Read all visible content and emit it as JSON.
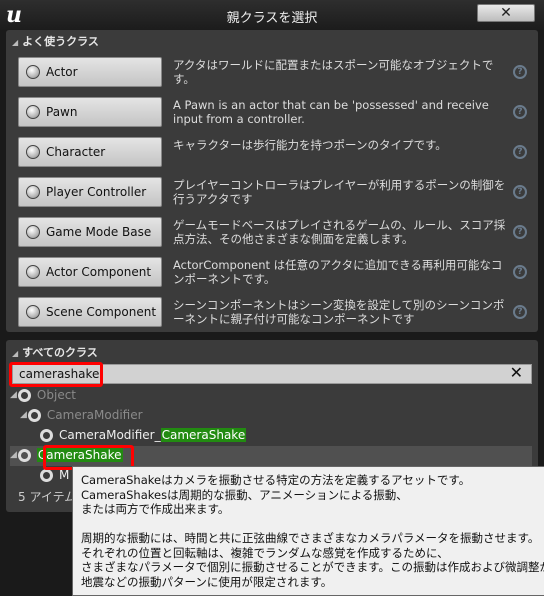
{
  "window": {
    "title": "親クラスを選択",
    "close_label": "✕"
  },
  "common": {
    "header": "よく使うクラス",
    "items": [
      {
        "label": "Actor",
        "desc": "アクタはワールドに配置またはスポーン可能なオブジェクトです。",
        "icon": "actor-sphere-icon"
      },
      {
        "label": "Pawn",
        "desc": "A Pawn is an actor that can be 'possessed' and receive input from a controller.",
        "icon": "pawn-icon"
      },
      {
        "label": "Character",
        "desc": "キャラクターは歩行能力を持つポーンのタイプです。",
        "icon": "character-icon"
      },
      {
        "label": "Player Controller",
        "desc": "プレイヤーコントローラはプレイヤーが利用するポーンの制御を行うアクタです",
        "icon": "player-controller-icon"
      },
      {
        "label": "Game Mode Base",
        "desc": "ゲームモードベースはプレイされるゲームの、ルール、スコア採点方法、その他さまざまな側面を定義します。",
        "icon": "game-mode-icon"
      },
      {
        "label": "Actor Component",
        "desc": "ActorComponent は任意のアクタに追加できる再利用可能なコンポーネントです。",
        "icon": "actor-component-icon"
      },
      {
        "label": "Scene Component",
        "desc": "シーンコンポーネントはシーン変換を設定して別のシーンコンポーネントに親子付け可能なコンポーネントです",
        "icon": "scene-component-icon"
      }
    ]
  },
  "all": {
    "header": "すべてのクラス",
    "search_value": "camerashake",
    "tree": [
      {
        "pre": "Object",
        "match": "",
        "post": ""
      },
      {
        "pre": "CameraModifier",
        "match": "",
        "post": ""
      },
      {
        "pre": "CameraModifier_",
        "match": "CameraShake",
        "post": ""
      },
      {
        "pre": "",
        "match": "CameraShake",
        "post": ""
      },
      {
        "pre": "M",
        "match": "",
        "post": ""
      }
    ],
    "count": "5 アイテム"
  },
  "tooltip": {
    "text": "CameraShakeはカメラを振動させる特定の方法を定義するアセットです。\nCameraShakesは周期的な振動、アニメーションによる振動、\nまたは両方で作成出来ます。\n\n周期的な振動には、時間と共に正弦曲線でさまざまなカメラパラメータを振動させます。\nそれぞれの位置と回転軸は、複雑でランダムな感覚を作成するために、\nさまざまなパラメータで個別に振動させることができます。この振動は作成および微調整が簡\n地震などの振動パターンに使用が限定されます。"
  },
  "colors": {
    "highlight": "#228b11",
    "annotation": "#ff0000",
    "panel": "#3b3b3b"
  }
}
